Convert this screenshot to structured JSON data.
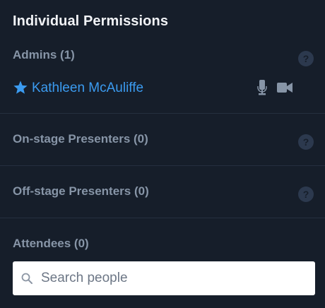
{
  "panel": {
    "title": "Individual Permissions"
  },
  "sections": {
    "admins": {
      "label": "Admins (1)",
      "help": "?"
    },
    "onstage": {
      "label": "On-stage Presenters (0)",
      "help": "?"
    },
    "offstage": {
      "label": "Off-stage Presenters (0)",
      "help": "?"
    },
    "attendees": {
      "label": "Attendees (0)"
    }
  },
  "admins": [
    {
      "name": "Kathleen McAuliffe",
      "icon": "star-icon",
      "mic": "microphone-icon",
      "camera": "video-camera-icon"
    }
  ],
  "search": {
    "placeholder": "Search people",
    "value": ""
  },
  "colors": {
    "background": "#161e2a",
    "title": "#f1f3f6",
    "section_label": "#8795a7",
    "accent": "#3b9bf0",
    "help_bg": "#2c394e",
    "divider": "#252f3f"
  }
}
